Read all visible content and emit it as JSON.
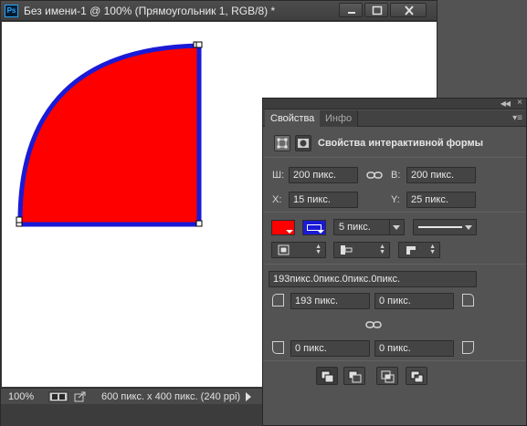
{
  "document": {
    "app_logo": "Ps",
    "title": "Без имени-1 @ 100% (Прямоугольник 1, RGB/8) *",
    "zoom": "100%",
    "doc_info": "600 пикс. x 400 пикс. (240 ppi)",
    "canvas": {
      "background": "#ffffff",
      "shape": {
        "type": "rounded-rectangle",
        "fill": "#ff0000",
        "stroke": "#1a1ad6"
      }
    }
  },
  "panel": {
    "tabs": [
      {
        "label": "Свойства",
        "active": true
      },
      {
        "label": "Инфо",
        "active": false
      }
    ],
    "section_title": "Свойства интерактивной формы",
    "size": {
      "w_label": "Ш:",
      "w_value": "200 пикс.",
      "h_label": "В:",
      "h_value": "200 пикс."
    },
    "position": {
      "x_label": "X:",
      "x_value": "15 пикс.",
      "y_label": "Y:",
      "y_value": "25 пикс."
    },
    "stroke": {
      "fill_color": "#ff0000",
      "stroke_color": "#1a1ad6",
      "width": "5 пикс."
    },
    "corners": {
      "summary": "193пикс.0пикс.0пикс.0пикс.",
      "top_left": "193 пикс.",
      "top_right": "0 пикс.",
      "bottom_left": "0 пикс.",
      "bottom_right": "0 пикс."
    }
  }
}
